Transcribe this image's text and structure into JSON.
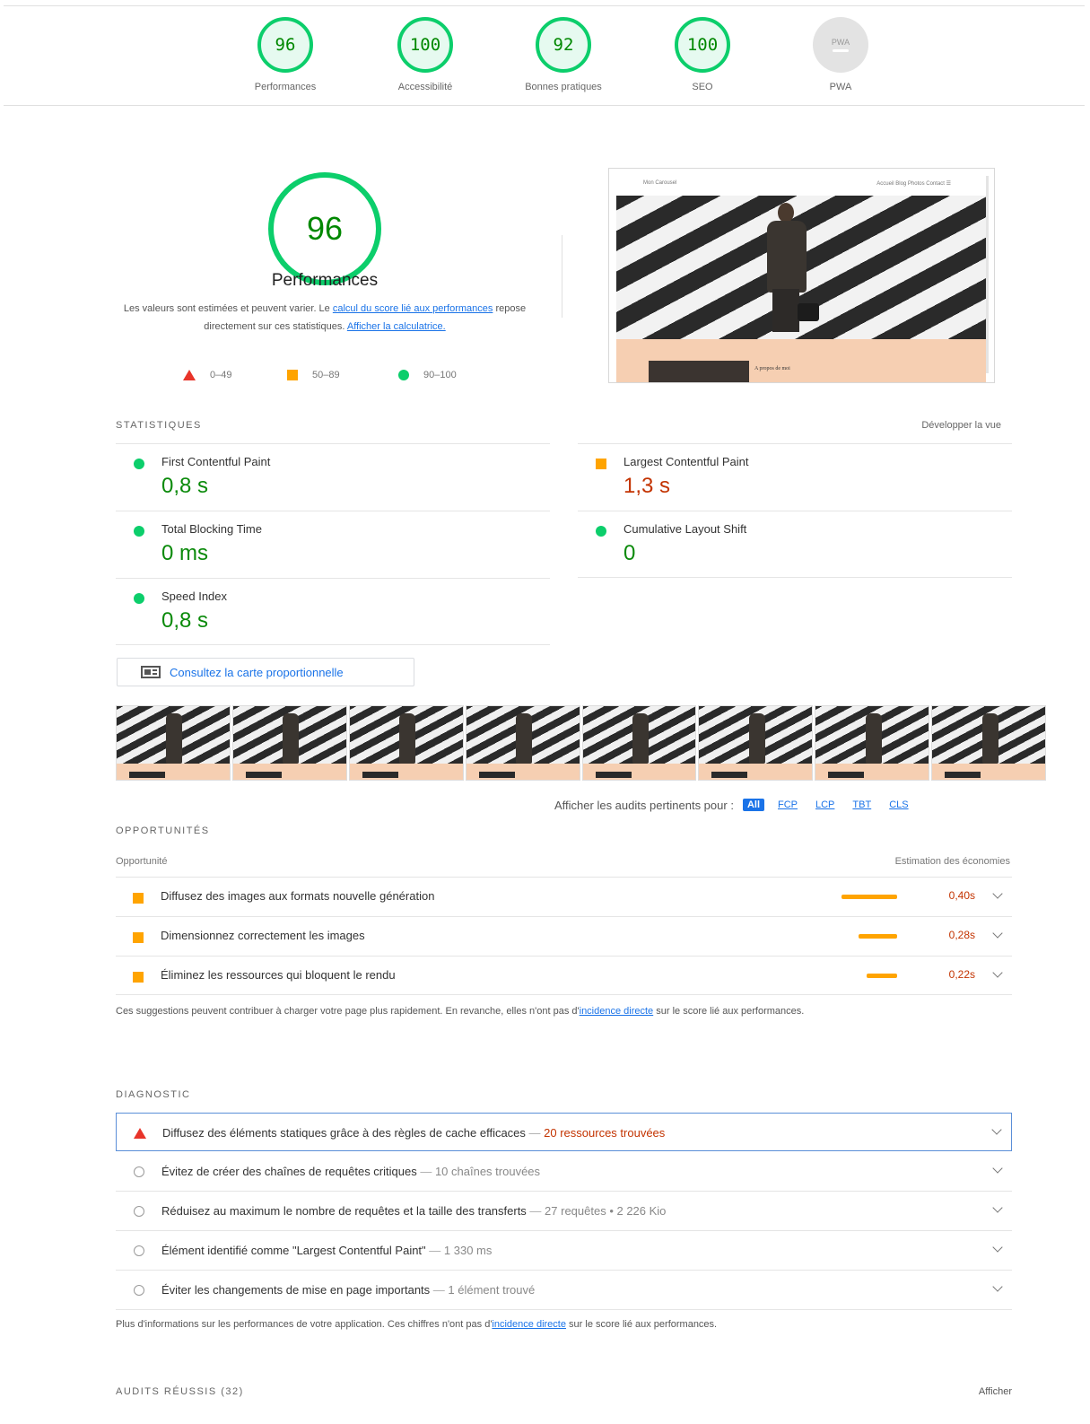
{
  "gauges": [
    {
      "score": "96",
      "label": "Performances"
    },
    {
      "score": "100",
      "label": "Accessibilité"
    },
    {
      "score": "92",
      "label": "Bonnes pratiques"
    },
    {
      "score": "100",
      "label": "SEO"
    },
    {
      "score": "PWA",
      "label": "PWA"
    }
  ],
  "main": {
    "score": "96",
    "title": "Performances",
    "desc_1": "Les valeurs sont estimées et peuvent varier. Le ",
    "desc_link_1": "calcul du score lié aux performances",
    "desc_2": " repose directement sur ces statistiques. ",
    "desc_link_2": "Afficher la calculatrice."
  },
  "legend": {
    "bad": "0–49",
    "average": "50–89",
    "good": "90–100"
  },
  "preview": {
    "brand": "Mon Carousel",
    "links": "Accueil   Blog   Photos   Contact   ☰",
    "caption": "A propos de moi"
  },
  "stats": {
    "title": "STATISTIQUES",
    "expand": "Développer la vue",
    "metrics": [
      {
        "name": "First Contentful Paint",
        "value": "0,8 s",
        "status": "good"
      },
      {
        "name": "Largest Contentful Paint",
        "value": "1,3 s",
        "status": "average"
      },
      {
        "name": "Total Blocking Time",
        "value": "0 ms",
        "status": "good"
      },
      {
        "name": "Cumulative Layout Shift",
        "value": "0",
        "status": "good"
      },
      {
        "name": "Speed Index",
        "value": "0,8 s",
        "status": "good"
      }
    ]
  },
  "treemap": {
    "label": "Consultez la carte proportionnelle",
    "icon": "treemap-icon"
  },
  "filter": {
    "label": "Afficher les audits pertinents pour :",
    "chips": [
      "All",
      "FCP",
      "LCP",
      "TBT",
      "CLS"
    ],
    "active": "All"
  },
  "opportunities": {
    "title": "OPPORTUNITÉS",
    "col_left": "Opportunité",
    "col_right": "Estimation des économies",
    "items": [
      {
        "name": "Diffusez des images aux formats nouvelle génération",
        "value": "0,40s",
        "fraction": 1.0
      },
      {
        "name": "Dimensionnez correctement les images",
        "value": "0,28s",
        "fraction": 0.7
      },
      {
        "name": "Éliminez les ressources qui bloquent le rendu",
        "value": "0,22s",
        "fraction": 0.55
      }
    ],
    "note_1": "Ces suggestions peuvent contribuer à charger votre page plus rapidement. En revanche, elles n'ont pas d'",
    "note_link": "incidence directe",
    "note_2": " sur le score lié aux performances."
  },
  "diagnostics": {
    "title": "DIAGNOSTIC",
    "items": [
      {
        "name": "Diffusez des éléments statiques grâce à des règles de cache efficaces",
        "detail": "20 ressources trouvées",
        "status": "bad"
      },
      {
        "name": "Évitez de créer des chaînes de requêtes critiques",
        "detail": "10 chaînes trouvées",
        "status": "info"
      },
      {
        "name": "Réduisez au maximum le nombre de requêtes et la taille des transferts",
        "detail": "27 requêtes • 2 226 Kio",
        "status": "info"
      },
      {
        "name": "Élément identifié comme \"Largest Contentful Paint\"",
        "detail": "1 330 ms",
        "status": "info"
      },
      {
        "name": "Éviter les changements de mise en page importants",
        "detail": "1 élément trouvé",
        "status": "info"
      }
    ],
    "note_1": "Plus d'informations sur les performances de votre application. Ces chiffres n'ont pas d'",
    "note_link": "incidence directe",
    "note_2": " sur le score lié aux performances."
  },
  "passed": {
    "title": "AUDITS RÉUSSIS (32)",
    "show": "Afficher"
  }
}
